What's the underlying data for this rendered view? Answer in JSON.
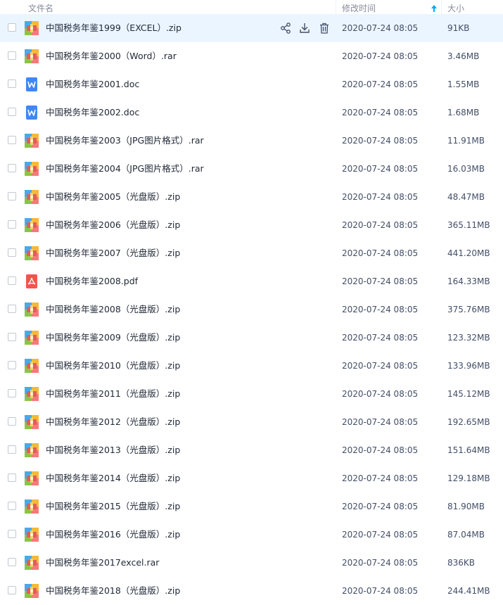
{
  "header": {
    "name_label": "文件名",
    "time_label": "修改时间",
    "size_label": "大小",
    "sort_icon": "arrow-up-icon"
  },
  "row_actions": {
    "share_icon": "share-icon",
    "download_icon": "download-icon",
    "delete_icon": "delete-icon"
  },
  "colors": {
    "accent": "#06a7ff",
    "selected_row": "#ebf5ff",
    "zip_icon": "#e25c5c",
    "doc_icon": "#3c88f7",
    "pdf_icon": "#f0554c"
  },
  "files": [
    {
      "name": "中国税务年鉴1999（EXCEL）.zip",
      "time": "2020-07-24 08:05",
      "size": "91KB",
      "type": "archive",
      "selected": true
    },
    {
      "name": "中国税务年鉴2000（Word）.rar",
      "time": "2020-07-24 08:05",
      "size": "3.46MB",
      "type": "archive"
    },
    {
      "name": "中国税务年鉴2001.doc",
      "time": "2020-07-24 08:05",
      "size": "1.55MB",
      "type": "word"
    },
    {
      "name": "中国税务年鉴2002.doc",
      "time": "2020-07-24 08:05",
      "size": "1.68MB",
      "type": "word"
    },
    {
      "name": "中国税务年鉴2003（JPG图片格式）.rar",
      "time": "2020-07-24 08:05",
      "size": "11.91MB",
      "type": "archive"
    },
    {
      "name": "中国税务年鉴2004（JPG图片格式）.rar",
      "time": "2020-07-24 08:05",
      "size": "16.03MB",
      "type": "archive"
    },
    {
      "name": "中国税务年鉴2005（光盘版）.zip",
      "time": "2020-07-24 08:05",
      "size": "48.47MB",
      "type": "archive"
    },
    {
      "name": "中国税务年鉴2006（光盘版）.zip",
      "time": "2020-07-24 08:05",
      "size": "365.11MB",
      "type": "archive"
    },
    {
      "name": "中国税务年鉴2007（光盘版）.zip",
      "time": "2020-07-24 08:05",
      "size": "441.20MB",
      "type": "archive"
    },
    {
      "name": "中国税务年鉴2008.pdf",
      "time": "2020-07-24 08:05",
      "size": "164.33MB",
      "type": "pdf"
    },
    {
      "name": "中国税务年鉴2008（光盘版）.zip",
      "time": "2020-07-24 08:05",
      "size": "375.76MB",
      "type": "archive"
    },
    {
      "name": "中国税务年鉴2009（光盘版）.zip",
      "time": "2020-07-24 08:05",
      "size": "123.32MB",
      "type": "archive"
    },
    {
      "name": "中国税务年鉴2010（光盘版）.zip",
      "time": "2020-07-24 08:05",
      "size": "133.96MB",
      "type": "archive"
    },
    {
      "name": "中国税务年鉴2011（光盘版）.zip",
      "time": "2020-07-24 08:05",
      "size": "145.12MB",
      "type": "archive"
    },
    {
      "name": "中国税务年鉴2012（光盘版）.zip",
      "time": "2020-07-24 08:05",
      "size": "192.65MB",
      "type": "archive"
    },
    {
      "name": "中国税务年鉴2013（光盘版）.zip",
      "time": "2020-07-24 08:05",
      "size": "151.64MB",
      "type": "archive"
    },
    {
      "name": "中国税务年鉴2014（光盘版）.zip",
      "time": "2020-07-24 08:05",
      "size": "129.18MB",
      "type": "archive"
    },
    {
      "name": "中国税务年鉴2015（光盘版）.zip",
      "time": "2020-07-24 08:05",
      "size": "81.90MB",
      "type": "archive"
    },
    {
      "name": "中国税务年鉴2016（光盘版）.zip",
      "time": "2020-07-24 08:05",
      "size": "87.04MB",
      "type": "archive"
    },
    {
      "name": "中国税务年鉴2017excel.rar",
      "time": "2020-07-24 08:05",
      "size": "836KB",
      "type": "archive"
    },
    {
      "name": "中国税务年鉴2018（光盘版）.zip",
      "time": "2020-07-24 08:05",
      "size": "244.41MB",
      "type": "archive"
    }
  ]
}
